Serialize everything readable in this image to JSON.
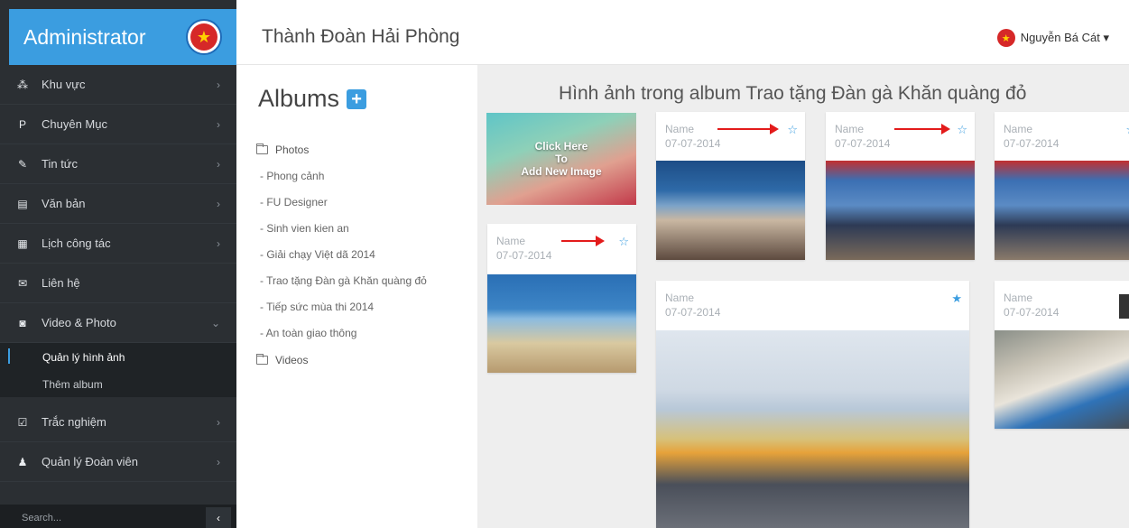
{
  "sidebar": {
    "brand": "Administrator",
    "items": [
      {
        "label": "Khu vực",
        "icon": "sitemap-icon"
      },
      {
        "label": "Chuyên Mục",
        "icon": "bookmark-icon"
      },
      {
        "label": "Tin tức",
        "icon": "pencil-icon"
      },
      {
        "label": "Văn bản",
        "icon": "document-icon"
      },
      {
        "label": "Lịch công tác",
        "icon": "calendar-icon"
      },
      {
        "label": "Liên hệ",
        "icon": "envelope-icon"
      },
      {
        "label": "Video & Photo",
        "icon": "camera-icon"
      },
      {
        "label": "Trắc nghiệm",
        "icon": "checkbox-icon"
      },
      {
        "label": "Quản lý Đoàn viên",
        "icon": "person-icon"
      }
    ],
    "submenu": [
      {
        "label": "Quản lý hình ảnh"
      },
      {
        "label": "Thêm album"
      }
    ],
    "search_placeholder": "Search...",
    "collapse_symbol": "‹"
  },
  "header": {
    "title": "Thành Đoàn Hải Phòng",
    "user_name": "Nguyễn Bá Cát ▾"
  },
  "albums": {
    "title": "Albums",
    "plus": "+",
    "photos_label": "Photos",
    "photo_albums": [
      "- Phong cảnh",
      "- FU Designer",
      "- Sinh vien kien an",
      "- Giải chạy Việt dã 2014",
      "- Trao tặng Đàn gà Khăn quàng đỏ",
      "- Tiếp sức mùa thi 2014",
      "- An toàn giao thông"
    ],
    "videos_label": "Videos"
  },
  "gallery": {
    "title": "Hình ảnh trong album Trao tặng Đàn gà Khăn quàng đỏ",
    "add_image_text": "Click Here To Add New Image",
    "cards": [
      {
        "name": "Name",
        "date": "07-07-2014",
        "starred": false
      },
      {
        "name": "Name",
        "date": "07-07-2014",
        "starred": false
      },
      {
        "name": "Name",
        "date": "07-07-2014",
        "starred": false
      },
      {
        "name": "Name",
        "date": "07-07-2014",
        "starred": false
      },
      {
        "name": "Name",
        "date": "07-07-2014",
        "starred": true
      },
      {
        "name": "Name",
        "date": "07-07-2014",
        "starred": false
      }
    ],
    "star_empty": "☆",
    "star_full": "★"
  },
  "colors": {
    "accent": "#3b9de0",
    "sidebar_bg": "#2b2f33",
    "arrow": "#e31b1b"
  }
}
